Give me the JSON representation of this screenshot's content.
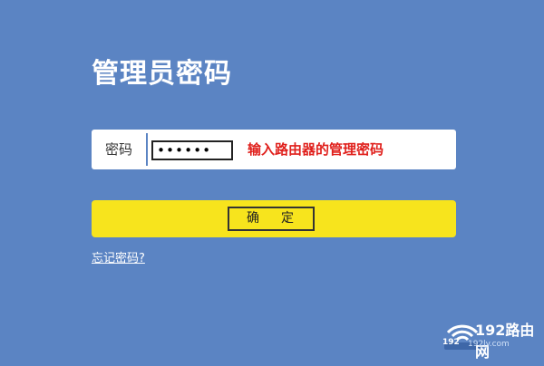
{
  "page": {
    "title": "管理员密码"
  },
  "login": {
    "password_label": "密码",
    "password_value": "••••••",
    "password_hint": "输入路由器的管理密码",
    "confirm_label_a": "确",
    "confirm_label_b": "定",
    "forgot_link": "忘记密码?"
  },
  "watermark": {
    "brand": "192路由网",
    "badge": "192",
    "url": "192ly.com"
  },
  "colors": {
    "background": "#5b84c3",
    "confirm_bar": "#f7e41d",
    "hint_text": "#e0201c"
  }
}
